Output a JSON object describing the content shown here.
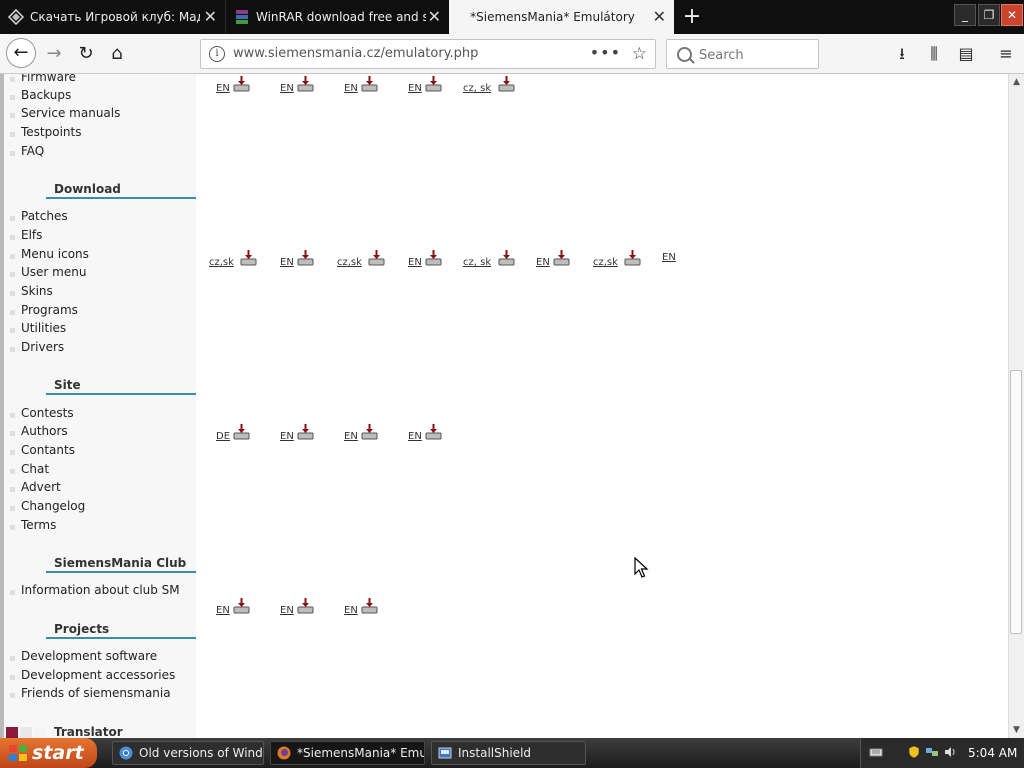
{
  "browser": {
    "tabs": [
      {
        "label": "Скачать Игровой клуб: Маджонг"
      },
      {
        "label": "WinRAR download free and support"
      },
      {
        "label": "*SiemensMania* Emulátory"
      }
    ],
    "url": "www.siemensmania.cz/emulatory.php",
    "search_placeholder": "Search",
    "window_controls": {
      "minimize": "_",
      "restore": "❐",
      "close": "✕"
    },
    "nav_icons": [
      "back-icon",
      "forward-icon",
      "reload-icon",
      "home-icon",
      "download-icon",
      "library-icon",
      "sidebar-icon",
      "menu-icon"
    ]
  },
  "sidebar": {
    "links_top": [
      "Firmware",
      "Backups",
      "Service manuals",
      "Testpoints",
      "FAQ"
    ],
    "sections": [
      {
        "title": "Download",
        "items": [
          "Patches",
          "Elfs",
          "Menu icons",
          "User menu",
          "Skins",
          "Programs",
          "Utilities",
          "Drivers"
        ]
      },
      {
        "title": "Site",
        "items": [
          "Contests",
          "Authors",
          "Contants",
          "Chat",
          "Advert",
          "Changelog",
          "Terms"
        ]
      },
      {
        "title": "SiemensMania Club",
        "items": [
          "Information about club SM"
        ]
      },
      {
        "title": "Projects",
        "items": [
          "Development software",
          "Development accessories",
          "Friends of siemensmania"
        ]
      },
      {
        "title": "Translator",
        "items": []
      }
    ]
  },
  "downloads": {
    "row1": [
      "EN",
      "EN",
      "EN",
      "EN",
      "cz, sk"
    ],
    "row2": [
      "cz,sk",
      "EN",
      "cz,sk",
      "EN",
      "cz, sk",
      "EN",
      "cz,sk"
    ],
    "row2_plain": "EN",
    "row3": [
      "DE",
      "EN",
      "EN",
      "EN"
    ],
    "row4": [
      "EN",
      "EN",
      "EN"
    ]
  },
  "taskbar": {
    "start_label": "start",
    "tasks": [
      {
        "label": "Old versions of Wind..."
      },
      {
        "label": "*SiemensMania* Emul..."
      },
      {
        "label": "InstallShield"
      }
    ],
    "clock": "5:04 AM"
  },
  "colors": {
    "accent_underline": "#3b8ea2",
    "start_button": "#d35a25",
    "close_button": "#c9452f"
  }
}
